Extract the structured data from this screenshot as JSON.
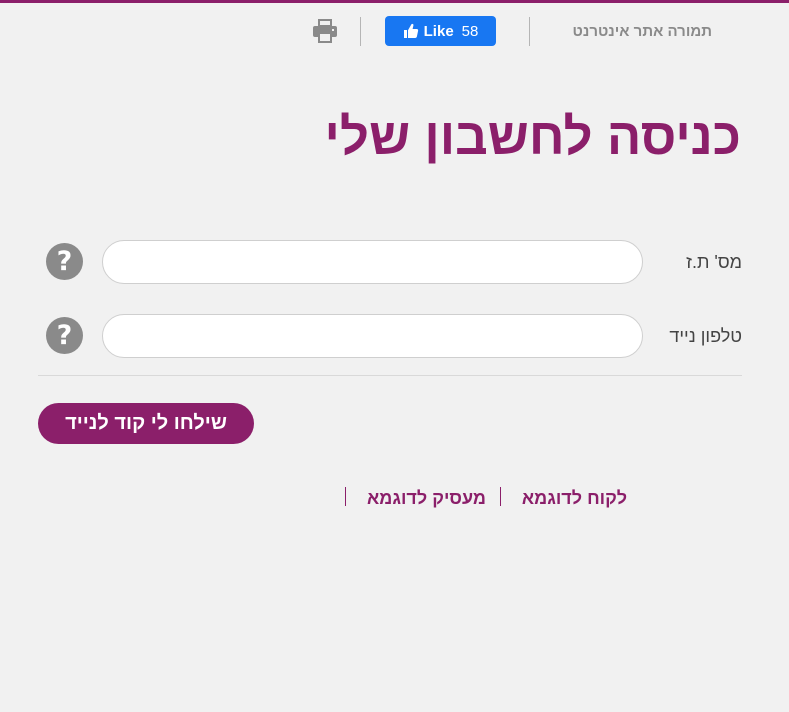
{
  "header": {
    "site_link_label": "תמורה אתר אינטרנט",
    "facebook_like": {
      "label": "Like",
      "count": "58",
      "color": "#1877f2"
    },
    "print_icon": "print-icon"
  },
  "page": {
    "title": "כניסה לחשבון שלי",
    "accent_color": "#8b1f6a"
  },
  "form": {
    "id_field": {
      "label": "מס' ת.ז",
      "value": "",
      "placeholder": "",
      "help_icon": "question-mark-icon",
      "help_glyph": "?"
    },
    "phone_field": {
      "label": "טלפון נייד",
      "value": "",
      "placeholder": "",
      "help_icon": "question-mark-icon",
      "help_glyph": "?"
    },
    "submit_label": "שילחו לי קוד לנייד"
  },
  "sample_links": {
    "customer": "לקוח לדוגמא",
    "employer": "מעסיק לדוגמא"
  }
}
